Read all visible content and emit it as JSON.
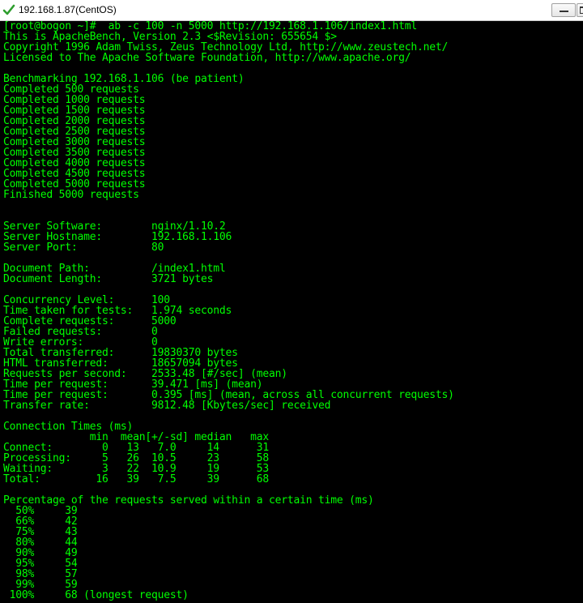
{
  "window": {
    "title": "192.168.1.87(CentOS)",
    "icon": "green-checkmark-icon"
  },
  "colors": {
    "terminal_fg": "#00ff00",
    "terminal_bg": "#000000"
  },
  "terminal": {
    "lines": [
      "[root@bogon ~]#  ab -c 100 -n 5000 http://192.168.1.106/index1.html",
      "This is ApacheBench, Version 2.3 <$Revision: 655654 $>",
      "Copyright 1996 Adam Twiss, Zeus Technology Ltd, http://www.zeustech.net/",
      "Licensed to The Apache Software Foundation, http://www.apache.org/",
      "",
      "Benchmarking 192.168.1.106 (be patient)",
      "Completed 500 requests",
      "Completed 1000 requests",
      "Completed 1500 requests",
      "Completed 2000 requests",
      "Completed 2500 requests",
      "Completed 3000 requests",
      "Completed 3500 requests",
      "Completed 4000 requests",
      "Completed 4500 requests",
      "Completed 5000 requests",
      "Finished 5000 requests",
      "",
      "",
      "Server Software:        nginx/1.10.2",
      "Server Hostname:        192.168.1.106",
      "Server Port:            80",
      "",
      "Document Path:          /index1.html",
      "Document Length:        3721 bytes",
      "",
      "Concurrency Level:      100",
      "Time taken for tests:   1.974 seconds",
      "Complete requests:      5000",
      "Failed requests:        0",
      "Write errors:           0",
      "Total transferred:      19830370 bytes",
      "HTML transferred:       18657094 bytes",
      "Requests per second:    2533.48 [#/sec] (mean)",
      "Time per request:       39.471 [ms] (mean)",
      "Time per request:       0.395 [ms] (mean, across all concurrent requests)",
      "Transfer rate:          9812.48 [Kbytes/sec] received",
      "",
      "Connection Times (ms)",
      "              min  mean[+/-sd] median   max",
      "Connect:        0   13   7.0     14      31",
      "Processing:     5   26  10.5     23      58",
      "Waiting:        3   22  10.9     19      53",
      "Total:         16   39   7.5     39      68",
      "",
      "Percentage of the requests served within a certain time (ms)",
      "  50%     39",
      "  66%     42",
      "  75%     43",
      "  80%     44",
      "  90%     49",
      "  95%     54",
      "  98%     57",
      "  99%     59",
      " 100%     68 (longest request)"
    ]
  }
}
